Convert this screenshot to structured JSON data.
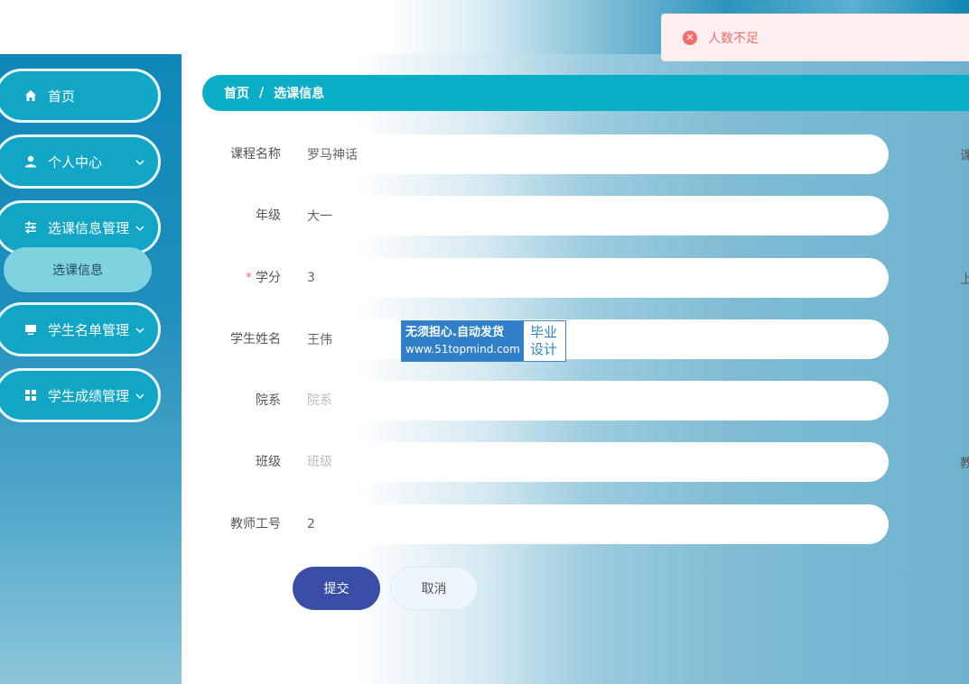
{
  "toast": {
    "icon": "error-circle-icon",
    "message": "人数不足"
  },
  "sidebar": {
    "items": [
      {
        "label": "首页",
        "icon": "home-icon"
      },
      {
        "label": "个人中心",
        "icon": "user-icon"
      },
      {
        "label": "选课信息管理",
        "icon": "sliders-icon"
      },
      {
        "label": "学生名单管理",
        "icon": "monitor-icon"
      },
      {
        "label": "学生成绩管理",
        "icon": "grid-icon"
      }
    ],
    "submenu": {
      "label": "选课信息"
    }
  },
  "breadcrumb": {
    "home": "首页",
    "separator": "/",
    "current": "选课信息"
  },
  "form": {
    "course_name": {
      "label": "课程名称",
      "value": "罗马神话"
    },
    "grade": {
      "label": "年级",
      "value": "大一"
    },
    "credit": {
      "label": "学分",
      "required_mark": "*",
      "value": "3"
    },
    "student_name": {
      "label": "学生姓名",
      "value": "王伟"
    },
    "department": {
      "label": "院系",
      "value": "",
      "placeholder": "院系"
    },
    "class": {
      "label": "班级",
      "value": "",
      "placeholder": "班级"
    },
    "teacher_id": {
      "label": "教师工号",
      "value": "2"
    },
    "right_column_stubs": [
      "课",
      "上",
      "教"
    ]
  },
  "buttons": {
    "submit": "提交",
    "cancel": "取消"
  },
  "watermark": {
    "line1": "无须担心.自动发货",
    "line2": "www.51topmind.com",
    "right_line1": "毕业",
    "right_line2": "设计"
  }
}
